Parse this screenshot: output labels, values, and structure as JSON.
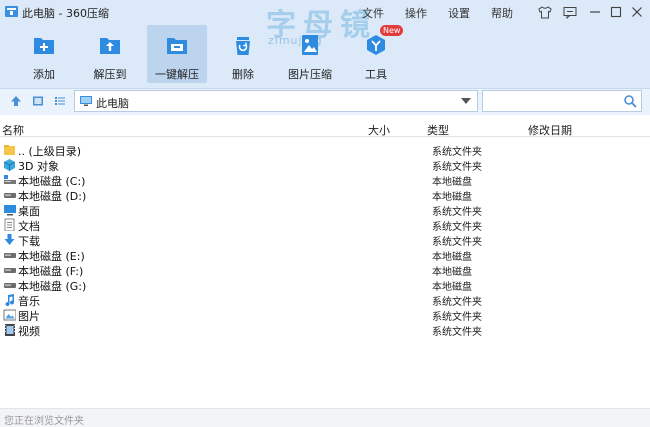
{
  "window": {
    "title": "此电脑 - 360压缩",
    "menu": [
      "文件",
      "操作",
      "设置",
      "帮助"
    ]
  },
  "watermark": {
    "main": "字母镜",
    "sub": "zimujing"
  },
  "toolbar": {
    "items": [
      {
        "label": "添加",
        "icon": "add-icon"
      },
      {
        "label": "解压到",
        "icon": "extract-to-icon"
      },
      {
        "label": "一键解压",
        "icon": "one-click-extract-icon"
      },
      {
        "label": "删除",
        "icon": "delete-icon"
      },
      {
        "label": "图片压缩",
        "icon": "image-compress-icon"
      },
      {
        "label": "工具",
        "icon": "tools-icon"
      }
    ],
    "new_badge": "New"
  },
  "address": {
    "path": "此电脑",
    "search_placeholder": ""
  },
  "columns": [
    "名称",
    "大小",
    "类型",
    "修改日期"
  ],
  "rows": [
    {
      "name": ".. (上级目录)",
      "type": "系统文件夹",
      "icon": "parent-folder-icon"
    },
    {
      "name": "3D 对象",
      "type": "系统文件夹",
      "icon": "3d-objects-icon"
    },
    {
      "name": "本地磁盘 (C:)",
      "type": "本地磁盘",
      "icon": "system-drive-icon"
    },
    {
      "name": "本地磁盘 (D:)",
      "type": "本地磁盘",
      "icon": "drive-icon"
    },
    {
      "name": "桌面",
      "type": "系统文件夹",
      "icon": "desktop-icon"
    },
    {
      "name": "文档",
      "type": "系统文件夹",
      "icon": "documents-icon"
    },
    {
      "name": "下载",
      "type": "系统文件夹",
      "icon": "downloads-icon"
    },
    {
      "name": "本地磁盘 (E:)",
      "type": "本地磁盘",
      "icon": "drive-icon"
    },
    {
      "name": "本地磁盘 (F:)",
      "type": "本地磁盘",
      "icon": "drive-icon"
    },
    {
      "name": "本地磁盘 (G:)",
      "type": "本地磁盘",
      "icon": "drive-icon"
    },
    {
      "name": "音乐",
      "type": "系统文件夹",
      "icon": "music-icon"
    },
    {
      "name": "图片",
      "type": "系统文件夹",
      "icon": "pictures-icon"
    },
    {
      "name": "视频",
      "type": "系统文件夹",
      "icon": "videos-icon"
    }
  ],
  "status": "您正在浏览文件夹",
  "colors": {
    "toolbar_bg": "#dbe9f8",
    "accent": "#2e8be0",
    "badge": "#e23b3b"
  }
}
